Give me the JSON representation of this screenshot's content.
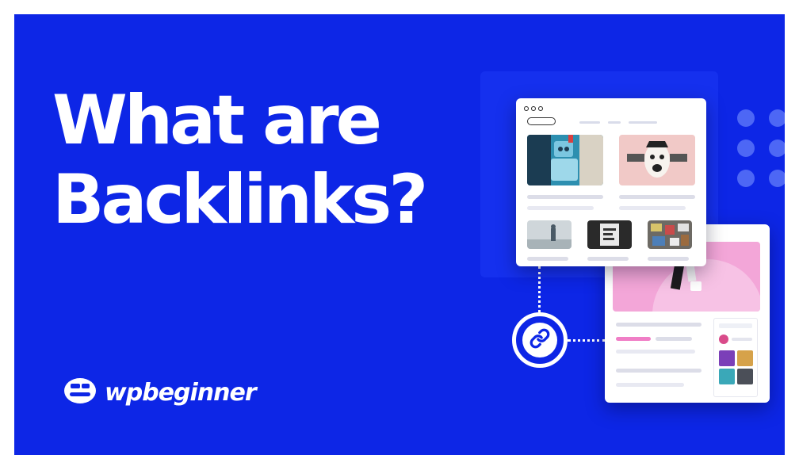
{
  "headline": {
    "line1": "What are",
    "line2": "Backlinks?"
  },
  "brand": {
    "name": "wpbeginner",
    "icon": "wpbeginner-logo-icon"
  },
  "colors": {
    "background": "#0d26e6",
    "card": "#ffffff",
    "accent_pink": "#f07ec6",
    "dots": "#4d67f5"
  },
  "illustration": {
    "link_icon": "link-icon",
    "window_controls": "window-dots-icon"
  }
}
